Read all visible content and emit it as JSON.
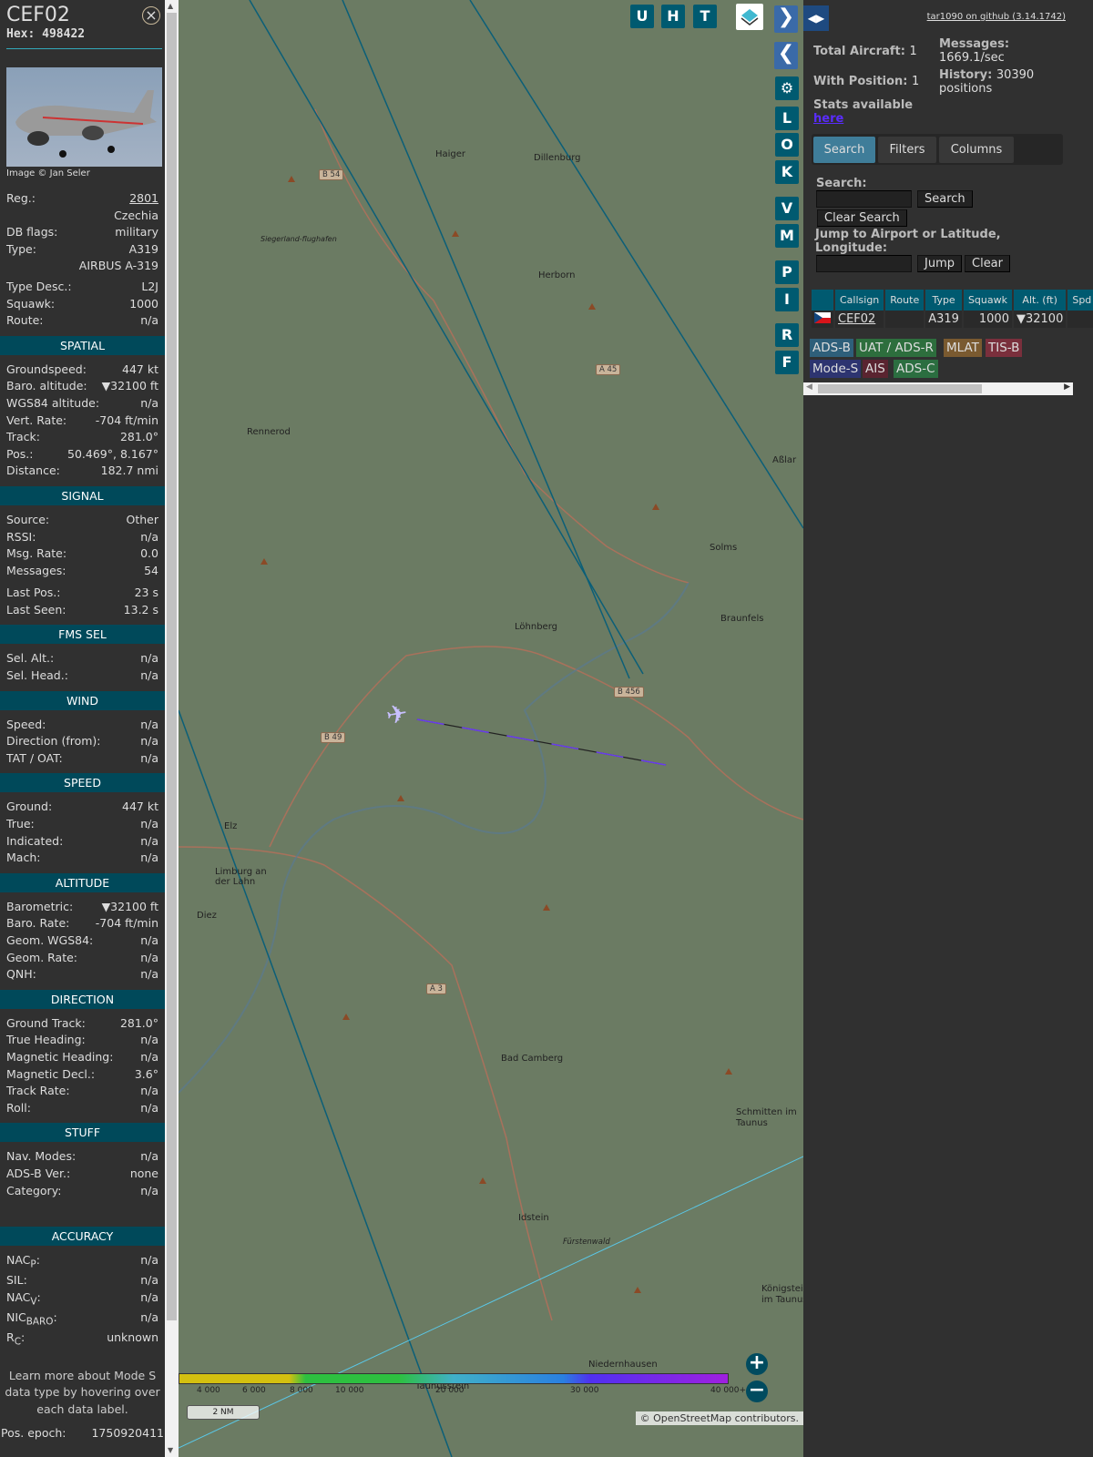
{
  "sidebar": {
    "callsign": "CEF02",
    "hex": "Hex: 498422",
    "image_credit": "Image © Jan Seler",
    "info": [
      {
        "l": "Reg.:",
        "v": "2801"
      },
      {
        "l": "",
        "v": "Czechia"
      },
      {
        "l": "DB flags:",
        "v": "military"
      },
      {
        "l": "Type:",
        "v": "A319"
      },
      {
        "l": "",
        "v": "AIRBUS A-319"
      },
      {
        "l": "Type Desc.:",
        "v": "L2J"
      },
      {
        "l": "Squawk:",
        "v": "1000"
      },
      {
        "l": "Route:",
        "v": "n/a"
      }
    ],
    "sections": [
      {
        "title": "SPATIAL",
        "rows": [
          {
            "l": "Groundspeed:",
            "v": "447 kt"
          },
          {
            "l": "Baro. altitude:",
            "v": "▼32100 ft"
          },
          {
            "l": "WGS84 altitude:",
            "v": "n/a"
          },
          {
            "l": "Vert. Rate:",
            "v": "-704 ft/min"
          },
          {
            "l": "Track:",
            "v": "281.0°"
          },
          {
            "l": "Pos.:",
            "v": "50.469°, 8.167°"
          },
          {
            "l": "Distance:",
            "v": "182.7 nmi"
          }
        ]
      },
      {
        "title": "SIGNAL",
        "rows": [
          {
            "l": "Source:",
            "v": "Other"
          },
          {
            "l": "RSSI:",
            "v": "n/a"
          },
          {
            "l": "Msg. Rate:",
            "v": "0.0"
          },
          {
            "l": "Messages:",
            "v": "54"
          },
          {
            "l": "Last Pos.:",
            "v": "23 s"
          },
          {
            "l": "Last Seen:",
            "v": "13.2 s"
          }
        ]
      },
      {
        "title": "FMS SEL",
        "rows": [
          {
            "l": "Sel. Alt.:",
            "v": "n/a"
          },
          {
            "l": "Sel. Head.:",
            "v": "n/a"
          }
        ]
      },
      {
        "title": "WIND",
        "rows": [
          {
            "l": "Speed:",
            "v": "n/a"
          },
          {
            "l": "Direction (from):",
            "v": "n/a"
          },
          {
            "l": "TAT / OAT:",
            "v": "n/a"
          }
        ]
      },
      {
        "title": "SPEED",
        "rows": [
          {
            "l": "Ground:",
            "v": "447 kt"
          },
          {
            "l": "True:",
            "v": "n/a"
          },
          {
            "l": "Indicated:",
            "v": "n/a"
          },
          {
            "l": "Mach:",
            "v": "n/a"
          }
        ]
      },
      {
        "title": "ALTITUDE",
        "rows": [
          {
            "l": "Barometric:",
            "v": "▼32100 ft"
          },
          {
            "l": "Baro. Rate:",
            "v": "-704 ft/min"
          },
          {
            "l": "Geom. WGS84:",
            "v": "n/a"
          },
          {
            "l": "Geom. Rate:",
            "v": "n/a"
          },
          {
            "l": "QNH:",
            "v": "n/a"
          }
        ]
      },
      {
        "title": "DIRECTION",
        "rows": [
          {
            "l": "Ground Track:",
            "v": "281.0°"
          },
          {
            "l": "True Heading:",
            "v": "n/a"
          },
          {
            "l": "Magnetic Heading:",
            "v": "n/a"
          },
          {
            "l": "Magnetic Decl.:",
            "v": "3.6°"
          },
          {
            "l": "Track Rate:",
            "v": "n/a"
          },
          {
            "l": "Roll:",
            "v": "n/a"
          }
        ]
      },
      {
        "title": "STUFF",
        "rows": [
          {
            "l": "Nav. Modes:",
            "v": "n/a"
          },
          {
            "l": "ADS-B Ver.:",
            "v": "none"
          },
          {
            "l": "Category:",
            "v": "n/a"
          }
        ]
      }
    ],
    "accuracy": {
      "title": "ACCURACY",
      "nacp": "NAC",
      "nacp_sub": "P",
      "nacp_v": "n/a",
      "sil": "SIL:",
      "sil_v": "n/a",
      "nacv": "NAC",
      "nacv_sub": "V",
      "nacv_v": "n/a",
      "nic": "NIC",
      "nic_sub": "BARO",
      "nic_v": "n/a",
      "rc": "R",
      "rc_sub": "C",
      "rc_v": "unknown"
    },
    "learn": "Learn more about Mode S data type by hovering over each data label.",
    "pos_epoch_label": "Pos. epoch:",
    "pos_epoch": "1750920411"
  },
  "map": {
    "buttons_top": [
      "U",
      "H",
      "T"
    ],
    "buttons_side": [
      "L",
      "O",
      "K",
      "V",
      "M",
      "P",
      "I",
      "R",
      "F"
    ],
    "towns": [
      {
        "n": "Haiger"
      },
      {
        "n": "Dillenburg"
      },
      {
        "n": "Siegerland-flughafen"
      },
      {
        "n": "Herborn"
      },
      {
        "n": "Rennerod"
      },
      {
        "n": "Aßlar"
      },
      {
        "n": "Solms"
      },
      {
        "n": "Löhnberg"
      },
      {
        "n": "Braunfels"
      },
      {
        "n": "Elz"
      },
      {
        "n": "Limburg an der Lahn"
      },
      {
        "n": "Diez"
      },
      {
        "n": "Bad Camberg"
      },
      {
        "n": "Schmitten im Taunus"
      },
      {
        "n": "Idstein"
      },
      {
        "n": "Fürstenwald"
      },
      {
        "n": "Königstein im Taunus"
      },
      {
        "n": "Niedernhausen"
      },
      {
        "n": "Taunusstein"
      }
    ],
    "roads": [
      "B 54",
      "A 45",
      "B 456",
      "B 49",
      "A 3"
    ],
    "legend": [
      "4 000",
      "6 000",
      "8 000",
      "10 000",
      "20 000",
      "30 000",
      "40 000+"
    ],
    "scale": "2 NM",
    "attribution_prefix": "© ",
    "attribution_link": "OpenStreetMap",
    "attribution_suffix": " contributors."
  },
  "right": {
    "github": "tar1090 on github (3.14.1742)",
    "total_aircraft": "Total Aircraft:",
    "total_aircraft_v": "1",
    "with_position": "With Position:",
    "with_position_v": "1",
    "messages": "Messages:",
    "messages_v": "1669.1/sec",
    "history": "History:",
    "history_v": "30390 positions",
    "stats": "Stats available",
    "stats_link": "here",
    "tabs": [
      "Search",
      "Filters",
      "Columns"
    ],
    "search_label": "Search:",
    "search_btn": "Search",
    "clear_search": "Clear Search",
    "jump_label": "Jump to Airport or Latitude, Longitude:",
    "jump_btn": "Jump",
    "clear_btn": "Clear",
    "columns": [
      "",
      "Callsign",
      "Route",
      "Type",
      "Squawk",
      "Alt. (ft)",
      "Spd"
    ],
    "row": {
      "callsign": "CEF02",
      "route": "",
      "type": "A319",
      "squawk": "1000",
      "alt": "▼32100",
      "spd": ""
    },
    "sources": [
      {
        "n": "ADS-B",
        "c": "#2e5f7a"
      },
      {
        "n": "UAT / ADS-R",
        "c": "#2d6e3d"
      },
      {
        "n": "MLAT",
        "c": "#7a5a30"
      },
      {
        "n": "TIS-B",
        "c": "#7a2f3c"
      },
      {
        "n": "Mode-S",
        "c": "#2d3470"
      },
      {
        "n": "AIS",
        "c": "#5a2430"
      },
      {
        "n": "ADS-C",
        "c": "#2b6e40"
      }
    ]
  }
}
